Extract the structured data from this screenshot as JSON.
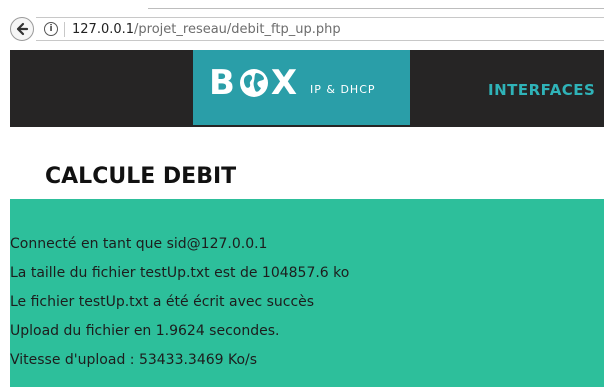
{
  "browser": {
    "url_host": "127.0.0.1",
    "url_path": "/projet_reseau/debit_ftp_up.php",
    "info_glyph": "i"
  },
  "navbar": {
    "logo_b": "B",
    "logo_x": "X",
    "logo_subtitle": "IP & DHCP",
    "nav_item": "INTERFACES",
    "colors": {
      "bar": "#262525",
      "logo_bg": "#2a9ea8",
      "nav_link": "#2fb3b8"
    }
  },
  "page": {
    "title": "CALCULE DEBIT"
  },
  "results": {
    "panel_color": "#2dbf9b",
    "lines": [
      "Connecté en tant que sid@127.0.0.1",
      "La taille du fichier testUp.txt est de 104857.6 ko",
      "Le fichier testUp.txt a été écrit avec succès",
      "Upload du fichier en 1.9624 secondes.",
      "Vitesse d'upload : 53433.3469 Ko/s"
    ]
  }
}
